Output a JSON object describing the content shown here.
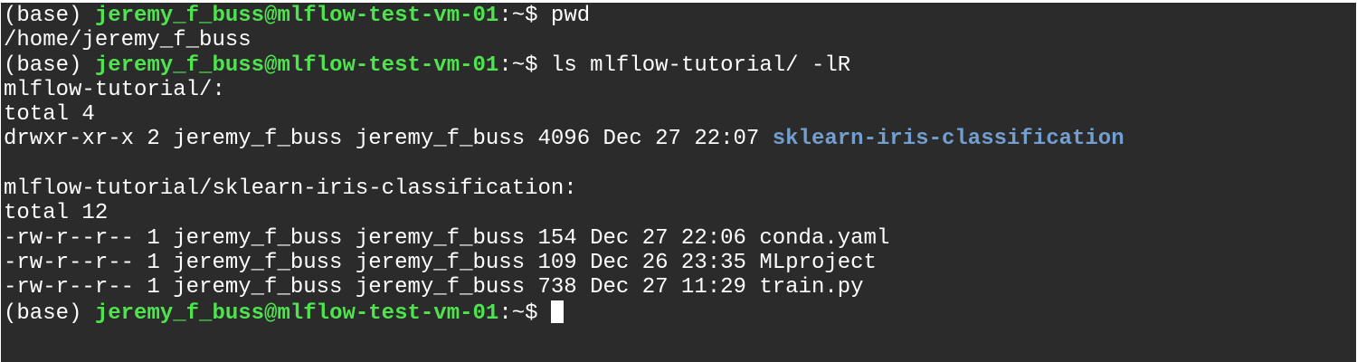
{
  "terminal": {
    "prompt_env": "(base) ",
    "user_host": "jeremy_f_buss@mlflow-test-vm-01",
    "prompt_path": ":~$ ",
    "colors": {
      "background": "#2b2b2b",
      "text": "#ffffff",
      "user_host": "#4ee44e",
      "directory": "#729fcf"
    },
    "lines": [
      {
        "type": "prompt",
        "command": "pwd"
      },
      {
        "type": "output",
        "text": "/home/jeremy_f_buss"
      },
      {
        "type": "prompt",
        "command": "ls mlflow-tutorial/ -lR"
      },
      {
        "type": "output",
        "text": "mlflow-tutorial/:"
      },
      {
        "type": "output",
        "text": "total 4"
      },
      {
        "type": "listing",
        "text": "drwxr-xr-x 2 jeremy_f_buss jeremy_f_buss 4096 Dec 27 22:07 ",
        "name": "sklearn-iris-classification"
      },
      {
        "type": "blank",
        "text": ""
      },
      {
        "type": "output",
        "text": "mlflow-tutorial/sklearn-iris-classification:"
      },
      {
        "type": "output",
        "text": "total 12"
      },
      {
        "type": "output",
        "text": "-rw-r--r-- 1 jeremy_f_buss jeremy_f_buss 154 Dec 27 22:06 conda.yaml"
      },
      {
        "type": "output",
        "text": "-rw-r--r-- 1 jeremy_f_buss jeremy_f_buss 109 Dec 26 23:35 MLproject"
      },
      {
        "type": "output",
        "text": "-rw-r--r-- 1 jeremy_f_buss jeremy_f_buss 738 Dec 27 11:29 train.py"
      },
      {
        "type": "prompt",
        "command": "",
        "cursor": true
      }
    ]
  }
}
